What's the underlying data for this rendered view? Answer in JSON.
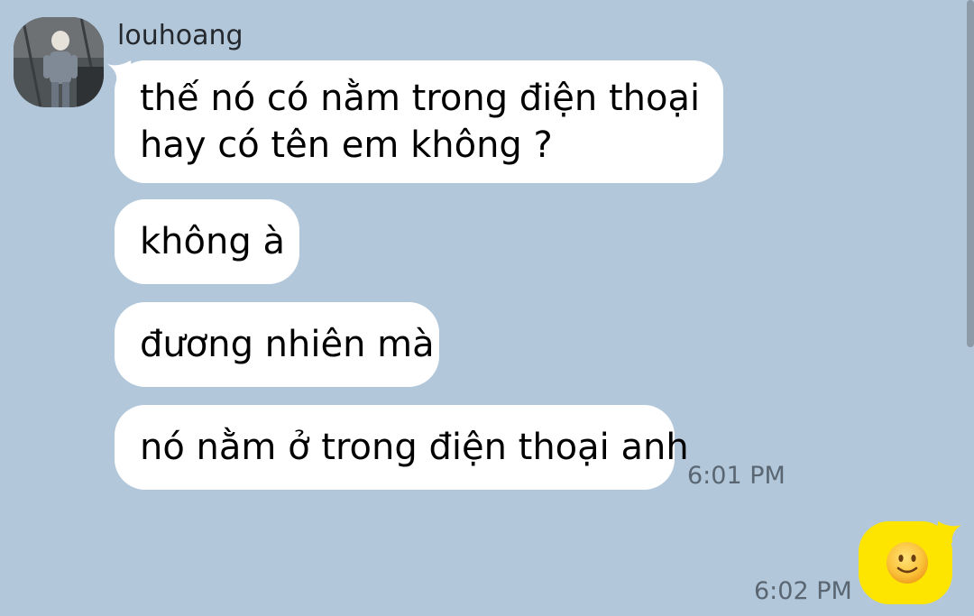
{
  "conversation": {
    "sender": {
      "name": "louhoang"
    },
    "incoming_messages": [
      {
        "lines": [
          "thế nó có nằm trong điện thoại",
          "hay có tên em không ?"
        ]
      },
      {
        "lines": [
          "không à"
        ]
      },
      {
        "lines": [
          "đương nhiên mà"
        ]
      },
      {
        "lines": [
          "nó nằm ở trong điện thoại anh"
        ]
      }
    ],
    "incoming_time": "6:01 PM",
    "outgoing_message": {
      "content_icon": "slightly-smiling-face-emoji",
      "time": "6:02 PM"
    }
  },
  "colors": {
    "background": "#b2c7da",
    "incoming_bubble": "#ffffff",
    "outgoing_bubble": "#fee500",
    "timestamp_text": "#5a6672"
  }
}
